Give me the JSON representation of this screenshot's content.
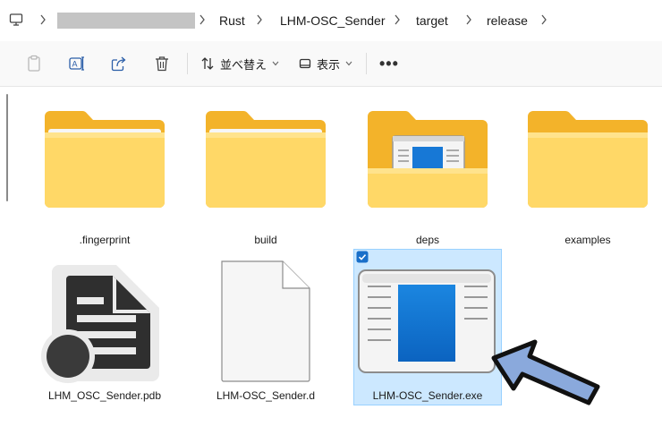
{
  "breadcrumb": {
    "items": [
      "Rust",
      "LHM-OSC_Sender",
      "target",
      "release"
    ]
  },
  "toolbar": {
    "sort_label": "並べ替え",
    "view_label": "表示",
    "more_label": "•••"
  },
  "files": [
    {
      "name": ".fingerprint",
      "icon": "folder-icon"
    },
    {
      "name": "build",
      "icon": "folder-icon"
    },
    {
      "name": "deps",
      "icon": "folder-with-content-icon"
    },
    {
      "name": "examples",
      "icon": "folder-icon"
    },
    {
      "name": "LHM_OSC_Sender.pdb",
      "icon": "pdb-file-icon"
    },
    {
      "name": "LHM-OSC_Sender.d",
      "icon": "blank-file-icon"
    },
    {
      "name": "LHM-OSC_Sender.exe",
      "icon": "exe-app-icon",
      "selected": true
    }
  ],
  "colors": {
    "selection_bg": "#cce8ff",
    "selection_border": "#99d1ff",
    "arrow_fill": "#8aa9dc",
    "folder_back": "#f3b32a",
    "folder_front": "#ffd867"
  }
}
